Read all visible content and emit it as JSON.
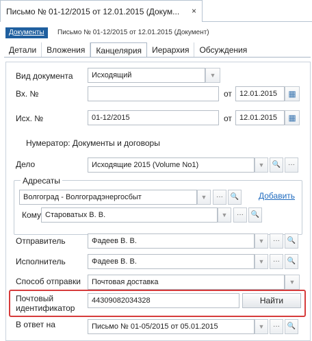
{
  "window_tab": {
    "title": "Письмо № 01-12/2015 от 12.01.2015 (Докум...",
    "close": "×"
  },
  "breadcrumb": {
    "link": "Документы",
    "current": "Письмо № 01-12/2015 от 12.01.2015 (Документ)"
  },
  "tabs": [
    {
      "label": "Детали"
    },
    {
      "label": "Вложения"
    },
    {
      "label": "Канцелярия",
      "active": true
    },
    {
      "label": "Иерархия"
    },
    {
      "label": "Обсуждения"
    }
  ],
  "form": {
    "doc_type_label": "Вид документа",
    "doc_type_value": "Исходящий",
    "in_no_label": "Вх. №",
    "in_no_value": "",
    "from_label": "от",
    "in_date": "12.01.2015",
    "out_no_label": "Исх. №",
    "out_no_value": "01-12/2015",
    "out_date": "12.01.2015",
    "numerator": "Нумератор: Документы и договоры",
    "case_label": "Дело",
    "case_value": "Исходящие 2015  (Volume No1)",
    "addressees_legend": "Адресаты",
    "addressee_value": "Волгоград - Волгоградэнергосбыт",
    "add_link": "Добавить",
    "to_label": "Кому",
    "to_value": "Староватых В. В.",
    "sender_label": "Отправитель",
    "sender_value": "Фадеев В. В.",
    "executor_label": "Исполнитель",
    "executor_value": "Фадеев В. В.",
    "send_method_label": "Способ отправки",
    "send_method_value": "Почтовая доставка",
    "postal_id_label_1": "Почтовый",
    "postal_id_label_2": "идентификатор",
    "postal_id_value": "44309082034328",
    "find_button": "Найти",
    "reply_label": "В ответ на",
    "reply_value": "Письмо № 01-05/2015 от 05.01.2015"
  },
  "icons": {
    "dropdown": "▼",
    "ellipsis": "···",
    "search": "🔍",
    "calendar": "▦"
  }
}
